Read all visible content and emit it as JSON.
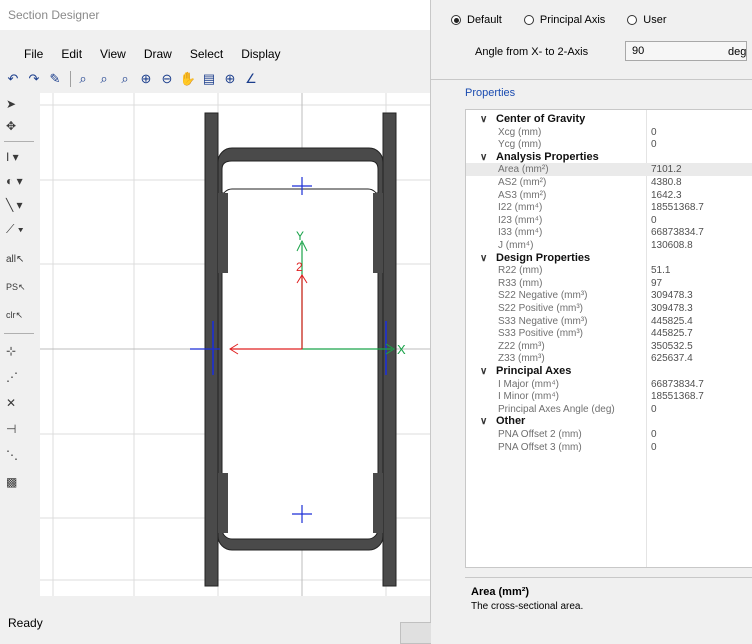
{
  "window": {
    "title": "Section Designer"
  },
  "menu": [
    "File",
    "Edit",
    "View",
    "Draw",
    "Select",
    "Display"
  ],
  "status": "Ready",
  "canvas": {
    "axis_x_label": "X",
    "axis_y_label": "Y",
    "axis_2_label": "2"
  },
  "left_tools": {
    "all": "all",
    "ps": "PS",
    "clr": "clr"
  },
  "orientation": {
    "options": [
      "Default",
      "Principal Axis",
      "User"
    ],
    "selected": "Default",
    "angle_label": "Angle from X- to 2-Axis",
    "angle_value": "90",
    "angle_unit": "deg"
  },
  "properties": {
    "label": "Properties",
    "categories": [
      {
        "name": "Center of Gravity",
        "items": [
          {
            "name": "Xcg (mm)",
            "value": "0"
          },
          {
            "name": "Ycg (mm)",
            "value": "0"
          }
        ]
      },
      {
        "name": "Analysis Properties",
        "items": [
          {
            "name": "Area (mm²)",
            "value": "7101.2"
          },
          {
            "name": "AS2 (mm²)",
            "value": "4380.8"
          },
          {
            "name": "AS3 (mm²)",
            "value": "1642.3"
          },
          {
            "name": "I22 (mm⁴)",
            "value": "18551368.7"
          },
          {
            "name": "I23 (mm⁴)",
            "value": "0"
          },
          {
            "name": "I33 (mm⁴)",
            "value": "66873834.7"
          },
          {
            "name": "J (mm⁴)",
            "value": "130608.8"
          }
        ]
      },
      {
        "name": "Design Properties",
        "items": [
          {
            "name": "R22 (mm)",
            "value": "51.1"
          },
          {
            "name": "R33 (mm)",
            "value": "97"
          },
          {
            "name": "S22 Negative (mm³)",
            "value": "309478.3"
          },
          {
            "name": "S22 Positive (mm³)",
            "value": "309478.3"
          },
          {
            "name": "S33 Negative (mm³)",
            "value": "445825.4"
          },
          {
            "name": "S33 Positive (mm³)",
            "value": "445825.7"
          },
          {
            "name": "Z22 (mm³)",
            "value": "350532.5"
          },
          {
            "name": "Z33 (mm³)",
            "value": "625637.4"
          }
        ]
      },
      {
        "name": "Principal Axes",
        "items": [
          {
            "name": "I Major (mm⁴)",
            "value": "66873834.7"
          },
          {
            "name": "I Minor (mm⁴)",
            "value": "18551368.7"
          },
          {
            "name": "Principal Axes Angle (deg)",
            "value": "0"
          }
        ]
      },
      {
        "name": "Other",
        "items": [
          {
            "name": "PNA Offset 2 (mm)",
            "value": "0"
          },
          {
            "name": "PNA Offset 3 (mm)",
            "value": "0"
          }
        ]
      }
    ]
  },
  "description": {
    "title": "Area (mm²)",
    "text": "The cross-sectional area."
  },
  "colors": {
    "axis_red": "#e02020",
    "axis_green": "#1aa34a",
    "marker_blue": "#1c2fd6",
    "section_fill": "#4a4a4a"
  }
}
